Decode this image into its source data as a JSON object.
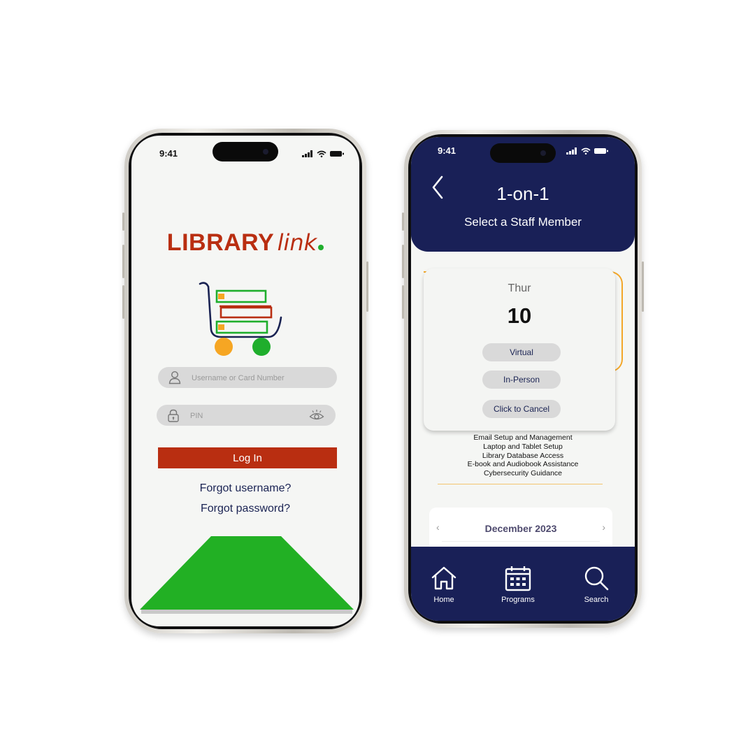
{
  "login_screen": {
    "status_time": "9:41",
    "logo": {
      "word": "LIBRARY",
      "script": "link"
    },
    "username": {
      "placeholder": "Username or Card Number",
      "icon": "user-icon"
    },
    "pin": {
      "placeholder": "PIN",
      "icon": "lock-icon",
      "toggle_icon": "eye-icon"
    },
    "login_label": "Log In",
    "forgot_username": "Forgot username?",
    "forgot_password": "Forgot password?",
    "colors": {
      "brand_red": "#b92e11",
      "brand_green": "#1fae2c",
      "accent_orange": "#f6a623",
      "navy": "#1a2353"
    }
  },
  "booking_screen": {
    "status_time": "9:41",
    "title": "1-on-1",
    "subtitle": "Select a Staff Member",
    "day_name": "Thur",
    "day_number": "10",
    "options": [
      "Virtual",
      "In-Person",
      "Click to Cancel"
    ],
    "services": [
      "Email Setup and Management",
      "Laptop and Tablet Setup",
      "Library Database Access",
      "E-book and Audiobook Assistance",
      "Cybersecurity Guidance"
    ],
    "calendar_month": "December 2023",
    "nav": [
      {
        "label": "Home",
        "icon": "home-icon"
      },
      {
        "label": "Programs",
        "icon": "calendar-icon"
      },
      {
        "label": "Search",
        "icon": "search-icon"
      }
    ],
    "colors": {
      "navy": "#192057",
      "accent_orange": "#f3a72a"
    }
  }
}
